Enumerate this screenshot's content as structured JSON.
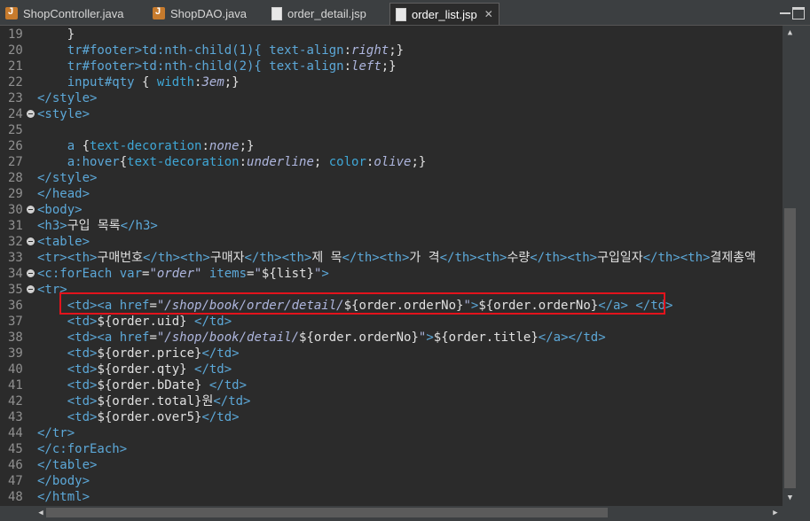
{
  "tabs": [
    {
      "label": "ShopController.java",
      "icon": "java-file-icon",
      "active": false
    },
    {
      "label": "ShopDAO.java",
      "icon": "java-file-icon",
      "active": false
    },
    {
      "label": "order_detail.jsp",
      "icon": "jsp-file-icon",
      "active": false
    },
    {
      "label": "order_list.jsp",
      "icon": "jsp-file-icon",
      "active": true
    }
  ],
  "close_glyph": "✕",
  "highlight": {
    "line": 36,
    "color": "#e3131c"
  },
  "lines": [
    {
      "n": "19",
      "fold": false,
      "t": [
        [
          "    }",
          "p"
        ]
      ]
    },
    {
      "n": "20",
      "fold": false,
      "t": [
        [
          "    tr#footer>td:nth-child(1){ ",
          "tg"
        ],
        [
          "text-align",
          ""
        ],
        [
          ":",
          "p"
        ],
        [
          "right",
          "va"
        ],
        [
          ";}",
          "p"
        ]
      ]
    },
    {
      "n": "21",
      "fold": false,
      "t": [
        [
          "    tr#footer>td:nth-child(2){ ",
          "tg"
        ],
        [
          "text-align",
          ""
        ],
        [
          ":",
          "p"
        ],
        [
          "left",
          "va"
        ],
        [
          ";}",
          "p"
        ]
      ]
    },
    {
      "n": "22",
      "fold": false,
      "t": [
        [
          "    input#qty ",
          "tg"
        ],
        [
          "{ ",
          "p"
        ],
        [
          "width",
          "pr"
        ],
        [
          ":",
          "p"
        ],
        [
          "3em",
          "va"
        ],
        [
          ";}",
          "p"
        ]
      ]
    },
    {
      "n": "23",
      "fold": false,
      "t": [
        [
          "</style>",
          "tg"
        ]
      ]
    },
    {
      "n": "24",
      "fold": true,
      "t": [
        [
          "<style>",
          "tg"
        ]
      ]
    },
    {
      "n": "25",
      "fold": false,
      "t": [
        [
          "",
          "p"
        ]
      ]
    },
    {
      "n": "26",
      "fold": false,
      "t": [
        [
          "    a ",
          "tg"
        ],
        [
          "{",
          "p"
        ],
        [
          "text-decoration",
          "pr"
        ],
        [
          ":",
          "p"
        ],
        [
          "none",
          "va"
        ],
        [
          ";}",
          "p"
        ]
      ]
    },
    {
      "n": "27",
      "fold": false,
      "t": [
        [
          "    a:hover",
          "tg"
        ],
        [
          "{",
          "p"
        ],
        [
          "text-decoration",
          "pr"
        ],
        [
          ":",
          "p"
        ],
        [
          "underline",
          "va"
        ],
        [
          "; ",
          "p"
        ],
        [
          "color",
          "pr"
        ],
        [
          ":",
          "p"
        ],
        [
          "olive",
          "va"
        ],
        [
          ";}",
          "p"
        ]
      ]
    },
    {
      "n": "28",
      "fold": false,
      "t": [
        [
          "</style>",
          "tg"
        ]
      ]
    },
    {
      "n": "29",
      "fold": false,
      "t": [
        [
          "</head>",
          "tg"
        ]
      ]
    },
    {
      "n": "30",
      "fold": true,
      "t": [
        [
          "<body>",
          "tg"
        ]
      ]
    },
    {
      "n": "31",
      "fold": false,
      "t": [
        [
          "<h3>",
          "tg"
        ],
        [
          "구입 목록",
          "p"
        ],
        [
          "</h3>",
          "tg"
        ]
      ]
    },
    {
      "n": "32",
      "fold": true,
      "t": [
        [
          "<table>",
          "tg"
        ]
      ]
    },
    {
      "n": "33",
      "fold": false,
      "t": [
        [
          "<tr><th>",
          "tg"
        ],
        [
          "구매번호",
          "p"
        ],
        [
          "</th><th>",
          "tg"
        ],
        [
          "구매자",
          "p"
        ],
        [
          "</th><th>",
          "tg"
        ],
        [
          "제 목",
          "p"
        ],
        [
          "</th><th>",
          "tg"
        ],
        [
          "가 격",
          "p"
        ],
        [
          "</th><th>",
          "tg"
        ],
        [
          "수량",
          "p"
        ],
        [
          "</th><th>",
          "tg"
        ],
        [
          "구입일자",
          "p"
        ],
        [
          "</th><th>",
          "tg"
        ],
        [
          "결제총액",
          "p"
        ]
      ]
    },
    {
      "n": "34",
      "fold": true,
      "t": [
        [
          "<c:forEach ",
          "tg"
        ],
        [
          "var",
          "at"
        ],
        [
          "=",
          "p"
        ],
        [
          "\"order\"",
          "st"
        ],
        [
          " items",
          "at"
        ],
        [
          "=",
          "p"
        ],
        [
          "\"",
          "st"
        ],
        [
          "${list}",
          "p"
        ],
        [
          "\"",
          "st"
        ],
        [
          ">",
          "tg"
        ]
      ]
    },
    {
      "n": "35",
      "fold": true,
      "t": [
        [
          "<tr>",
          "tg"
        ]
      ]
    },
    {
      "n": "36",
      "fold": false,
      "t": [
        [
          "    <td><a ",
          "tg"
        ],
        [
          "href",
          "at"
        ],
        [
          "=",
          "p"
        ],
        [
          "\"/shop/book/order/detail/",
          "st"
        ],
        [
          "${order.orderNo}",
          "p"
        ],
        [
          "\"",
          "st"
        ],
        [
          ">",
          "tg"
        ],
        [
          "${order.orderNo}",
          "p"
        ],
        [
          "</a> </td>",
          "tg"
        ]
      ]
    },
    {
      "n": "37",
      "fold": false,
      "t": [
        [
          "    <td>",
          "tg"
        ],
        [
          "${order.uid}",
          "p"
        ],
        [
          " </td>",
          "tg"
        ]
      ]
    },
    {
      "n": "38",
      "fold": false,
      "t": [
        [
          "    <td><a ",
          "tg"
        ],
        [
          "href",
          "at"
        ],
        [
          "=",
          "p"
        ],
        [
          "\"/shop/book/detail/",
          "st"
        ],
        [
          "${order.orderNo}",
          "p"
        ],
        [
          "\"",
          "st"
        ],
        [
          ">",
          "tg"
        ],
        [
          "${order.title}",
          "p"
        ],
        [
          "</a></td>",
          "tg"
        ]
      ]
    },
    {
      "n": "39",
      "fold": false,
      "t": [
        [
          "    <td>",
          "tg"
        ],
        [
          "${order.price}",
          "p"
        ],
        [
          "</td>",
          "tg"
        ]
      ]
    },
    {
      "n": "40",
      "fold": false,
      "t": [
        [
          "    <td>",
          "tg"
        ],
        [
          "${order.qty}",
          "p"
        ],
        [
          " </td>",
          "tg"
        ]
      ]
    },
    {
      "n": "41",
      "fold": false,
      "t": [
        [
          "    <td>",
          "tg"
        ],
        [
          "${order.bDate}",
          "p"
        ],
        [
          " </td>",
          "tg"
        ]
      ]
    },
    {
      "n": "42",
      "fold": false,
      "t": [
        [
          "    <td>",
          "tg"
        ],
        [
          "${order.total}",
          "p"
        ],
        [
          "원",
          "p"
        ],
        [
          "</td>",
          "tg"
        ]
      ]
    },
    {
      "n": "43",
      "fold": false,
      "t": [
        [
          "    <td>",
          "tg"
        ],
        [
          "${order.over5}",
          "p"
        ],
        [
          "</td>",
          "tg"
        ]
      ]
    },
    {
      "n": "44",
      "fold": false,
      "t": [
        [
          "</tr>",
          "tg"
        ]
      ]
    },
    {
      "n": "45",
      "fold": false,
      "t": [
        [
          "</c:forEach>",
          "tg"
        ]
      ]
    },
    {
      "n": "46",
      "fold": false,
      "t": [
        [
          "</table>",
          "tg"
        ]
      ]
    },
    {
      "n": "47",
      "fold": false,
      "t": [
        [
          "</body>",
          "tg"
        ]
      ]
    },
    {
      "n": "48",
      "fold": false,
      "t": [
        [
          "</html>",
          "tg"
        ]
      ]
    }
  ]
}
